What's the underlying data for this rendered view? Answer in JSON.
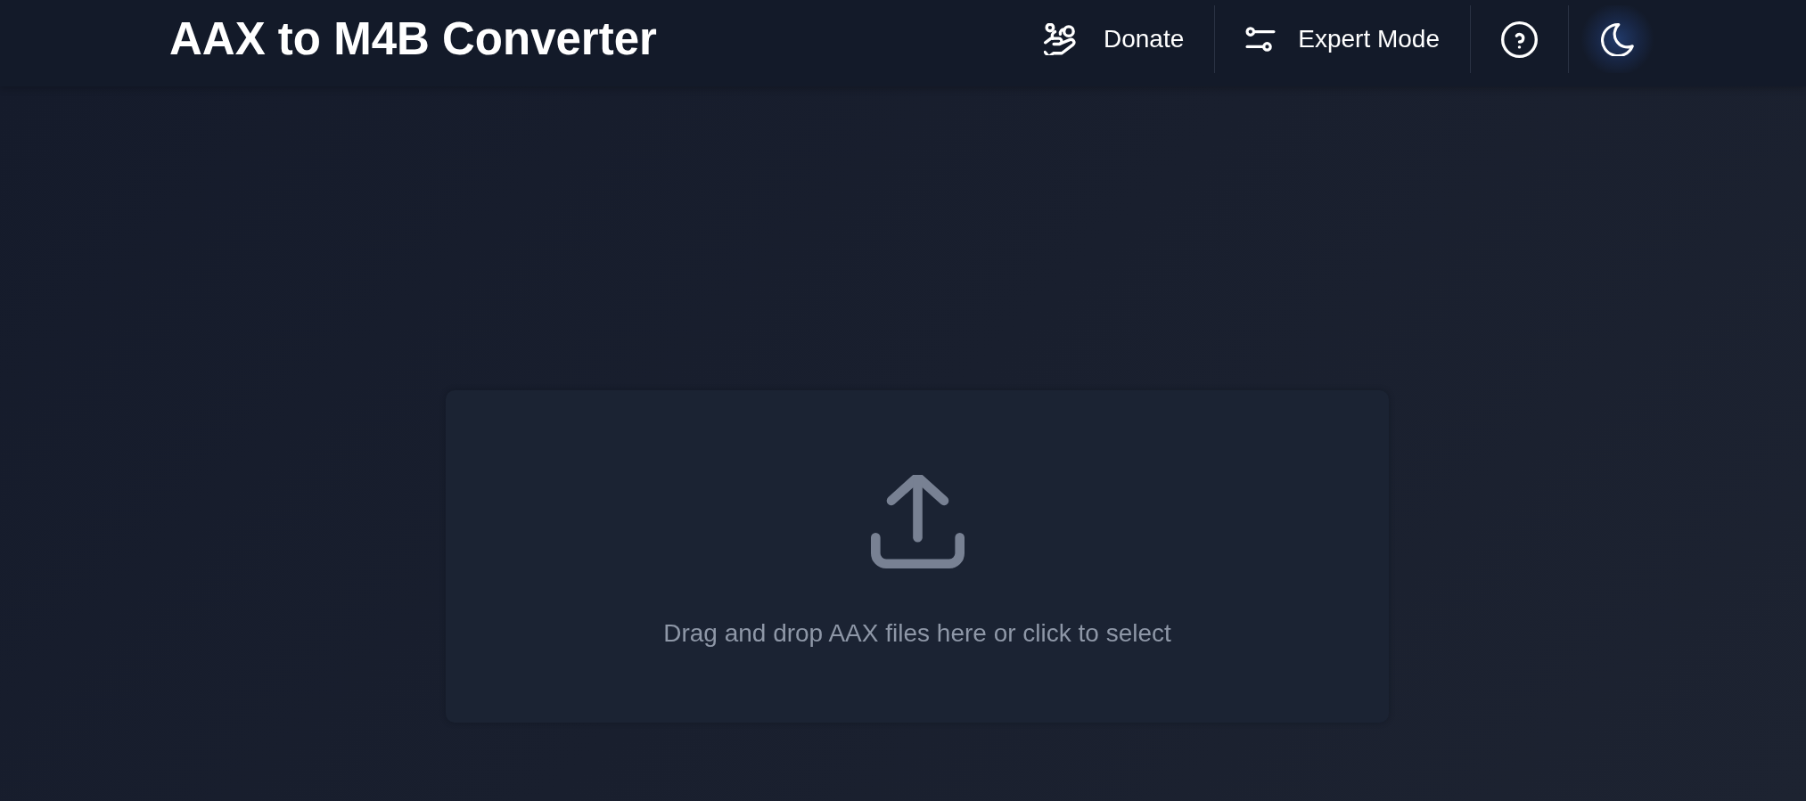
{
  "header": {
    "title": "AAX to M4B Converter",
    "nav": [
      {
        "kind": "donate",
        "label": "Donate"
      },
      {
        "kind": "expert",
        "label": "Expert Mode"
      },
      {
        "kind": "help"
      },
      {
        "kind": "theme"
      }
    ]
  },
  "dropzone": {
    "text": "Drag and drop AAX files here or click to select"
  }
}
